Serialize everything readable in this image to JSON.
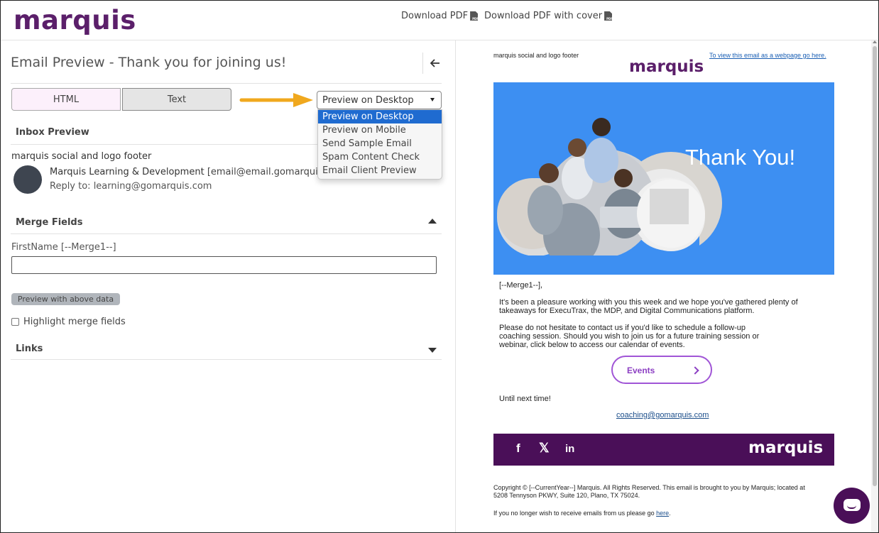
{
  "brand": {
    "name": "marquis",
    "color": "#5b1f6a"
  },
  "toolbar": {
    "download_pdf": "Download PDF",
    "download_pdf_cover": "Download PDF with cover",
    "pdf_icon_text": "PDF"
  },
  "left": {
    "title": "Email Preview - Thank you for joining us!",
    "back_icon": "arrow-left-icon",
    "format_tabs": {
      "html": "HTML",
      "text": "Text"
    },
    "preview_select": {
      "value": "Preview on Desktop",
      "options": [
        "Preview on Desktop",
        "Preview on Mobile",
        "Send Sample Email",
        "Spam Content Check",
        "Email Client Preview"
      ]
    },
    "inbox_preview": {
      "heading": "Inbox Preview",
      "from_name": "marquis social and logo footer",
      "sender": "Marquis Learning & Development",
      "sender_email": "[email@email.gomarquis.com",
      "reply_to": "Reply to: learning@gomarquis.com"
    },
    "merge_fields": {
      "heading": "Merge Fields",
      "field_label": "FirstName [--Merge1--]",
      "field_value": "",
      "preview_button": "Preview with above data",
      "highlight_label": "Highlight merge fields",
      "highlight_checked": false
    },
    "links": {
      "heading": "Links"
    }
  },
  "email": {
    "footer_label": "marquis social and logo footer",
    "web_link": "To view this email as a webpage go here.",
    "logo": "marquis",
    "hero_title": "Thank You!",
    "hero_color": "#3d8ff2",
    "greeting": "[--Merge1--],",
    "para1_line1": "It's been a pleasure working with you this week and we hope you've gathered plenty of",
    "para1_line2": "takeaways for ExecuTrax, the MDP, and Digital Communications platform.",
    "para2_line1": "Please do not hesitate to contact us if you'd like to schedule a follow-up",
    "para2_line2": "coaching session. Should you wish to join us for a future training session or",
    "para2_line3": "webinar, click below to access our calendar of events.",
    "events_button": "Events",
    "closing": "Until next time!",
    "contact_link": "coaching@gomarquis.com",
    "social": {
      "facebook": "f",
      "x": "𝕏",
      "linkedin": "in",
      "logo": "marquis",
      "bg_color": "#4a0f58"
    },
    "copyright_line1": "Copyright © [--CurrentYear--] Marquis. All Rights Reserved. This email is brought to you by Marquis; located at",
    "copyright_line2": "5208 Tennyson PKWY, Suite 120, Plano, TX 75024.",
    "unsub_text": "If you no longer wish to receive emails from us please go",
    "unsub_link": "here",
    "unsub_end": "."
  },
  "chat": {
    "icon": "chat-bubble-icon"
  },
  "colors": {
    "accent_orange": "#f0a81e",
    "select_highlight": "#1f6bd0",
    "event_purple": "#a055d6"
  }
}
